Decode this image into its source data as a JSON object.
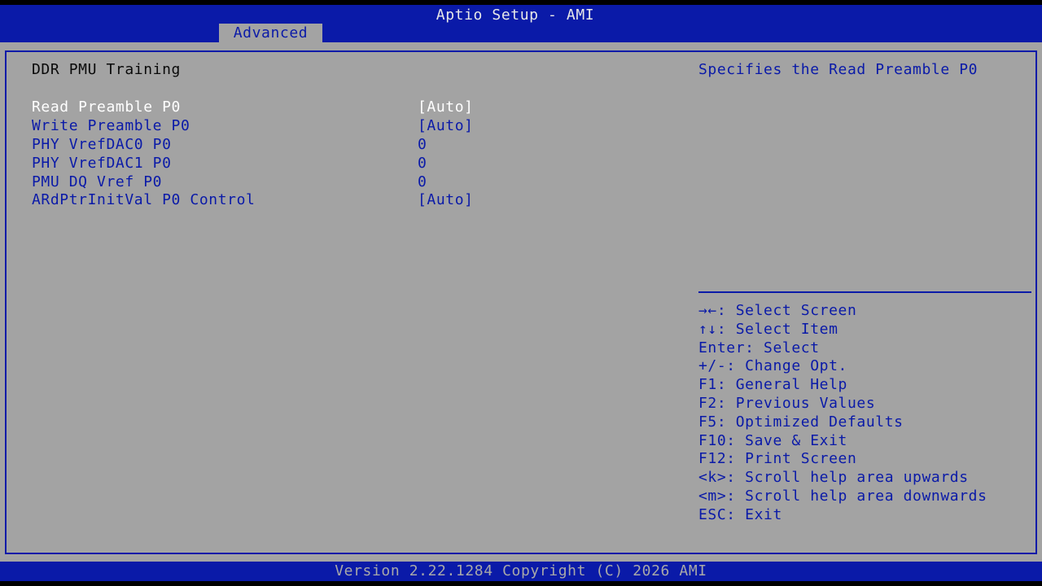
{
  "header": {
    "title": "Aptio Setup - AMI",
    "tabs": [
      {
        "label": "Advanced",
        "active": true
      }
    ]
  },
  "main": {
    "section_title": "DDR PMU Training",
    "items": [
      {
        "label": "Read Preamble P0",
        "value": "[Auto]",
        "selected": true
      },
      {
        "label": "Write Preamble P0",
        "value": "[Auto]",
        "selected": false
      },
      {
        "label": "PHY VrefDAC0 P0",
        "value": "0",
        "selected": false
      },
      {
        "label": "PHY VrefDAC1 P0",
        "value": "0",
        "selected": false
      },
      {
        "label": "PMU DQ Vref P0",
        "value": "0",
        "selected": false
      },
      {
        "label": "ARdPtrInitVal P0 Control",
        "value": "[Auto]",
        "selected": false
      }
    ]
  },
  "help": {
    "description": "Specifies the Read Preamble P0",
    "keys": [
      "→←: Select Screen",
      "↑↓: Select Item",
      "Enter: Select",
      "+/-: Change Opt.",
      "F1: General Help",
      "F2: Previous Values",
      "F5: Optimized Defaults",
      "F10: Save & Exit",
      "F12: Print Screen",
      "<k>: Scroll help area upwards",
      "<m>: Scroll help area downwards",
      "ESC: Exit"
    ]
  },
  "footer": {
    "text": "Version 2.22.1284 Copyright (C) 2026 AMI"
  },
  "colors": {
    "bios_blue": "#0a1aa8",
    "panel_gray": "#a3a3a3",
    "selected_text": "#ffffff"
  }
}
